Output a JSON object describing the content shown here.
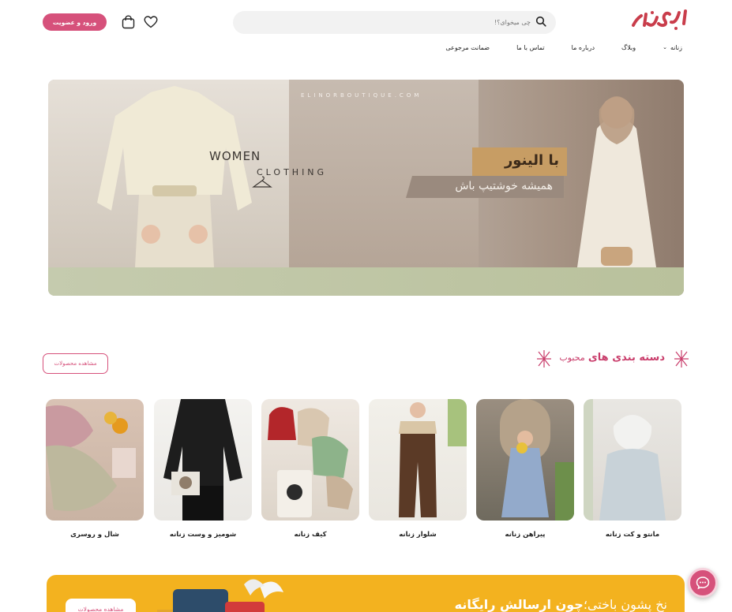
{
  "header": {
    "logo_text": "الینور",
    "search_placeholder": "چی میخوای؟!",
    "login_label": "ورود و عضویت"
  },
  "nav": {
    "items": [
      {
        "label": "زنانه",
        "has_dropdown": true
      },
      {
        "label": "وبلاگ"
      },
      {
        "label": "درباره ما"
      },
      {
        "label": "تماس با ما"
      },
      {
        "label": "ضمانت مرجوعی"
      }
    ]
  },
  "banner": {
    "site": "ELINORBOUTIQUE.COM",
    "women": "WOMEN",
    "clothing": "CLOTHING",
    "brand_tag": "با الینور",
    "slogan": "همیشه خوشتیپ باش"
  },
  "categories_section": {
    "title_strong": "دسته بندی های",
    "title_light": "محبوب",
    "view_button": "مشاهده محصولات",
    "items": [
      {
        "label": "مانتو و کت زنانه",
        "image": "coat-photo"
      },
      {
        "label": "پیراهن زنانه",
        "image": "dress-photo"
      },
      {
        "label": "شلوار زنانه",
        "image": "pants-photo"
      },
      {
        "label": "کیف زنانه",
        "image": "bags-photo"
      },
      {
        "label": "شومیز و وست زنانه",
        "image": "blouse-photo"
      },
      {
        "label": "شال و روسری",
        "image": "scarf-photo"
      }
    ]
  },
  "promo": {
    "title_light": "نخ پشون باختی؛",
    "title_bold": "چون ارسالش رایگانه",
    "button_label": "مشاهده محصولات"
  },
  "colors": {
    "accent": "#d6517b",
    "title_red": "#c93d6b",
    "promo_yellow": "#f3b21f"
  },
  "icons": {
    "search": "search-icon",
    "cart": "shopping-bag-icon",
    "favorites": "heart-icon",
    "chat": "chat-icon"
  }
}
